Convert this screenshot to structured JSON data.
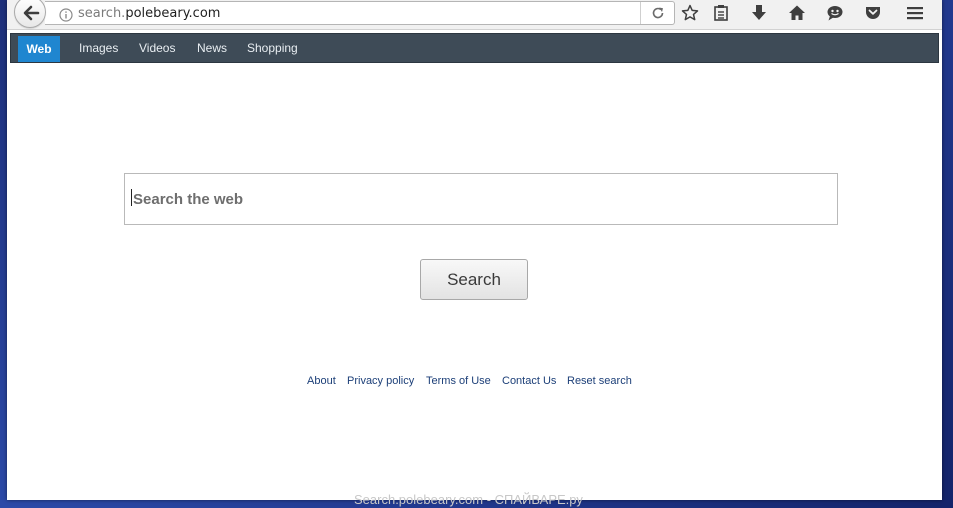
{
  "browser": {
    "url_prefix": "search.",
    "url_domain": "polebeary.com"
  },
  "nav": {
    "items": [
      {
        "label": "Web",
        "active": true
      },
      {
        "label": "Images",
        "active": false
      },
      {
        "label": "Videos",
        "active": false
      },
      {
        "label": "News",
        "active": false
      },
      {
        "label": "Shopping",
        "active": false
      }
    ]
  },
  "search": {
    "placeholder": "Search the web",
    "button_label": "Search"
  },
  "footer": {
    "links": [
      "About",
      "Privacy policy",
      "Terms of Use",
      "Contact Us",
      "Reset search"
    ]
  },
  "watermark": "Search.polebeary.com - СПАЙВАРЕ.ру",
  "colors": {
    "nav_bg": "#3e4b57",
    "nav_active": "#1f86d0",
    "link": "#1c3f78",
    "desktop": "#22398f"
  },
  "icons": [
    "back-arrow-icon",
    "info-icon",
    "reload-icon",
    "bookmark-star-icon",
    "reading-list-icon",
    "downloads-icon",
    "home-icon",
    "chat-icon",
    "pocket-icon",
    "menu-icon"
  ]
}
